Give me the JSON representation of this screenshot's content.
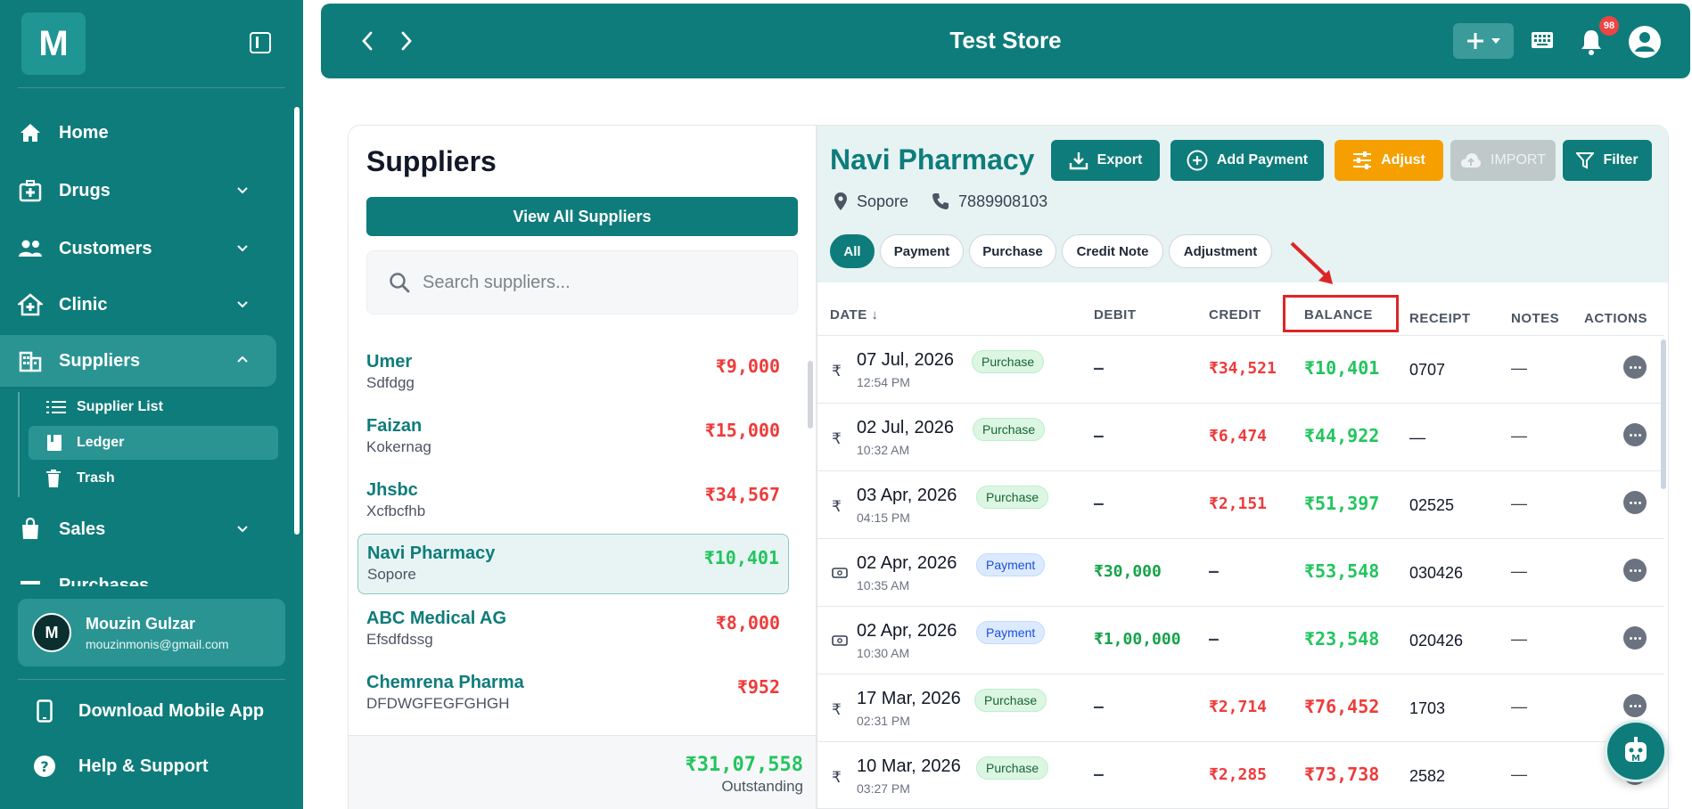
{
  "app": {
    "logo_letter": "M",
    "store_name": "Test Store",
    "notification_count": "98"
  },
  "sidebar": {
    "items": [
      {
        "label": "Home"
      },
      {
        "label": "Drugs"
      },
      {
        "label": "Customers"
      },
      {
        "label": "Clinic"
      },
      {
        "label": "Suppliers"
      },
      {
        "label": "Sales"
      },
      {
        "label": "Purchases"
      }
    ],
    "sub_items": [
      {
        "label": "Supplier List"
      },
      {
        "label": "Ledger"
      },
      {
        "label": "Trash"
      }
    ],
    "user": {
      "initial": "M",
      "name": "Mouzin Gulzar",
      "email": "mouzinmonis@gmail.com"
    },
    "bottom": [
      {
        "label": "Download Mobile App"
      },
      {
        "label": "Help & Support"
      }
    ]
  },
  "suppliers": {
    "title": "Suppliers",
    "view_all_label": "View All Suppliers",
    "search_placeholder": "Search suppliers...",
    "list": [
      {
        "name": "Umer",
        "location": "Sdfdgg",
        "amount": "₹9,000",
        "status": "red"
      },
      {
        "name": "Faizan",
        "location": "Kokernag",
        "amount": "₹15,000",
        "status": "red"
      },
      {
        "name": "Jhsbc",
        "location": "Xcfbcfhb",
        "amount": "₹34,567",
        "status": "red"
      },
      {
        "name": "Navi Pharmacy",
        "location": "Sopore",
        "amount": "₹10,401",
        "status": "green"
      },
      {
        "name": "ABC Medical AG",
        "location": "Efsdfdssg",
        "amount": "₹8,000",
        "status": "red"
      },
      {
        "name": "Chemrena Pharma",
        "location": "DFDWGFEGFGHGH",
        "amount": "₹952",
        "status": "red"
      }
    ],
    "outstanding_amount": "₹31,07,558",
    "outstanding_label": "Outstanding"
  },
  "ledger": {
    "supplier_name": "Navi Pharmacy",
    "location": "Sopore",
    "phone": "7889908103",
    "buttons": {
      "export": "Export",
      "add_payment": "Add Payment",
      "adjust": "Adjust",
      "import": "IMPORT",
      "filter": "Filter"
    },
    "filters": [
      "All",
      "Payment",
      "Purchase",
      "Credit Note",
      "Adjustment"
    ],
    "active_filter": "All",
    "columns": {
      "date": "DATE ↓",
      "debit": "DEBIT",
      "credit": "CREDIT",
      "balance": "BALANCE",
      "receipt": "RECEIPT",
      "notes": "NOTES",
      "actions": "ACTIONS"
    },
    "rows": [
      {
        "icon": "₹",
        "date": "07 Jul, 2026",
        "time": "12:54 PM",
        "type": "Purchase",
        "debit": "—",
        "credit": "₹34,521",
        "balance": "₹10,401",
        "balance_color": "green",
        "receipt": "0707",
        "notes": "—"
      },
      {
        "icon": "₹",
        "date": "02 Jul, 2026",
        "time": "10:32 AM",
        "type": "Purchase",
        "debit": "—",
        "credit": "₹6,474",
        "balance": "₹44,922",
        "balance_color": "green",
        "receipt": "—",
        "notes": "—"
      },
      {
        "icon": "₹",
        "date": "03 Apr, 2026",
        "time": "04:15 PM",
        "type": "Purchase",
        "debit": "—",
        "credit": "₹2,151",
        "balance": "₹51,397",
        "balance_color": "green",
        "receipt": "02525",
        "notes": "—"
      },
      {
        "icon": "cash",
        "date": "02 Apr, 2026",
        "time": "10:35 AM",
        "type": "Payment",
        "debit": "₹30,000",
        "credit": "—",
        "balance": "₹53,548",
        "balance_color": "green",
        "receipt": "030426",
        "notes": "—"
      },
      {
        "icon": "cash",
        "date": "02 Apr, 2026",
        "time": "10:30 AM",
        "type": "Payment",
        "debit": "₹1,00,000",
        "credit": "—",
        "balance": "₹23,548",
        "balance_color": "green",
        "receipt": "020426",
        "notes": "—"
      },
      {
        "icon": "₹",
        "date": "17 Mar, 2026",
        "time": "02:31 PM",
        "type": "Purchase",
        "debit": "—",
        "credit": "₹2,714",
        "balance": "₹76,452",
        "balance_color": "red",
        "receipt": "1703",
        "notes": "—"
      },
      {
        "icon": "₹",
        "date": "10 Mar, 2026",
        "time": "03:27 PM",
        "type": "Purchase",
        "debit": "—",
        "credit": "₹2,285",
        "balance": "₹73,738",
        "balance_color": "red",
        "receipt": "2582",
        "notes": "—"
      }
    ]
  },
  "colors": {
    "brand": "#0e7c7b",
    "adjust": "#f5a000",
    "debit_green": "#16a34a",
    "credit_red": "#ef3b3b",
    "annotation_red": "#dc2626"
  }
}
